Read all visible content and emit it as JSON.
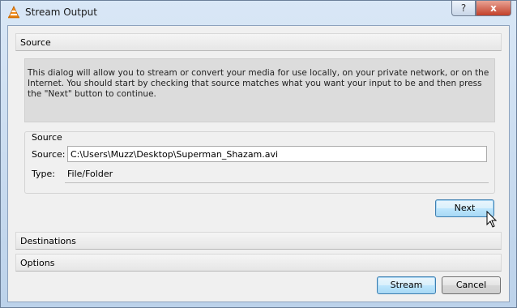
{
  "window": {
    "title": "Stream Output",
    "help_label": "?",
    "close_label": "x"
  },
  "sections": {
    "source_header": "Source",
    "destinations_header": "Destinations",
    "options_header": "Options"
  },
  "info": {
    "text": "This dialog will allow you to stream or convert your media for use locally, on your private network, or on the Internet. You should start by checking that source matches what you want your input to be and then press the \"Next\" button to continue."
  },
  "source_group": {
    "title": "Source",
    "source_label": "Source:",
    "source_value": "C:\\Users\\Muzz\\Desktop\\Superman_Shazam.avi",
    "type_label": "Type:",
    "type_value": "File/Folder"
  },
  "buttons": {
    "next": "Next",
    "stream": "Stream",
    "cancel": "Cancel"
  },
  "icons": {
    "app": "vlc-cone-icon",
    "cursor": "mouse-pointer-icon"
  },
  "colors": {
    "vlc_orange": "#f28c1a",
    "close_red": "#c3402a",
    "focus_blue": "#3c7fb1"
  }
}
